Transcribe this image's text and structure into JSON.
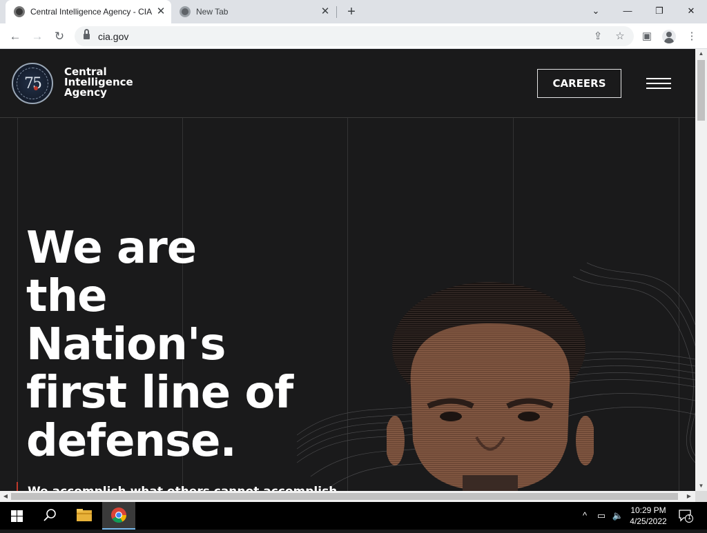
{
  "browser": {
    "tabs": [
      {
        "title": "Central Intelligence Agency - CIA",
        "active": true
      },
      {
        "title": "New Tab",
        "active": false
      }
    ],
    "address": "cia.gov",
    "window_controls": {
      "minimize": "—",
      "restore": "❐",
      "close": "✕"
    }
  },
  "site": {
    "wordmark": [
      "Central",
      "Intelligence",
      "Agency"
    ],
    "seal_number": "75",
    "careers_label": "CAREERS",
    "headline": [
      "We are",
      "the",
      "Nation's",
      "first line of",
      "defense."
    ],
    "subline_partial": "We accomplish what others cannot accomplish"
  },
  "taskbar": {
    "time": "10:29 PM",
    "date": "4/25/2022",
    "notification_count": "1"
  },
  "colors": {
    "page_background": "#1a1a1b",
    "accent_red": "#c0392b",
    "tabbar": "#dee1e6"
  }
}
